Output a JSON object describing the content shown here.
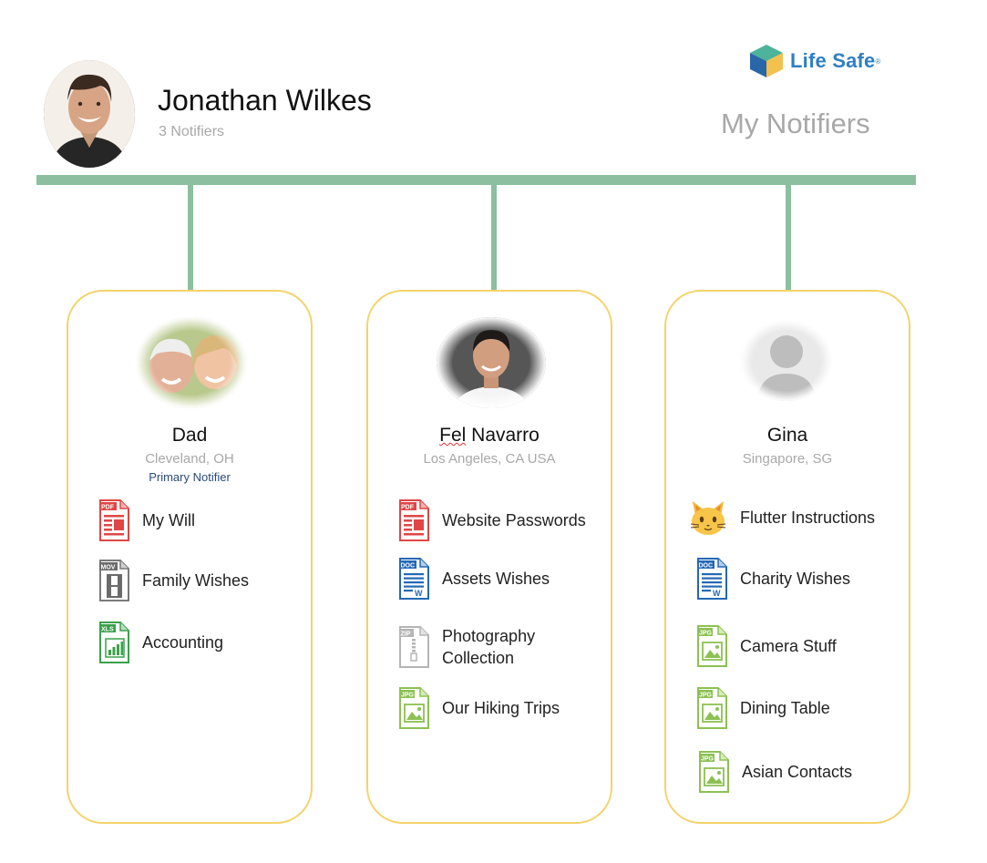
{
  "user": {
    "name": "Jonathan Wilkes",
    "notifier_count": "3 Notifiers"
  },
  "brand": {
    "name": "Life Safe",
    "reg_mark": "®"
  },
  "page_title": "My Notifiers",
  "colors": {
    "connector": "#8cbfa0",
    "card_border": "#f3d36a",
    "brand": "#2f7fc1",
    "muted_text": "#a8a8a8",
    "badge_text": "#2b4b7a"
  },
  "notifiers": [
    {
      "name": "Dad",
      "location": "Cleveland, OH",
      "badge": "Primary Notifier",
      "files": [
        {
          "label": "My Will",
          "type": "PDF",
          "icon": "pdf-file-icon"
        },
        {
          "label": "Family Wishes",
          "type": "MOV",
          "icon": "video-file-icon"
        },
        {
          "label": "Accounting",
          "type": "XLS",
          "icon": "spreadsheet-file-icon"
        }
      ]
    },
    {
      "name_first": "Fel",
      "name_last": " Navarro",
      "location": "Los Angeles, CA  USA",
      "files": [
        {
          "label": "Website Passwords",
          "type": "PDF",
          "icon": "pdf-file-icon"
        },
        {
          "label": "Assets Wishes",
          "type": "DOC",
          "icon": "word-file-icon"
        },
        {
          "label_line1": "Photography",
          "label_line2": "Collection",
          "type": "ZIP",
          "icon": "zip-file-icon"
        },
        {
          "label": "Our Hiking Trips",
          "type": "JPG",
          "icon": "image-file-icon"
        }
      ]
    },
    {
      "name": "Gina",
      "location": "Singapore, SG",
      "files": [
        {
          "label": "Flutter Instructions",
          "icon": "cat-icon"
        },
        {
          "label": "Charity Wishes",
          "type": "DOC",
          "icon": "word-file-icon"
        },
        {
          "label": "Camera Stuff",
          "type": "JPG",
          "icon": "image-file-icon"
        },
        {
          "label": "Dining Table",
          "type": "JPG",
          "icon": "image-file-icon"
        },
        {
          "label": "Asian Contacts",
          "type": "JPG",
          "icon": "image-file-icon"
        }
      ]
    }
  ]
}
